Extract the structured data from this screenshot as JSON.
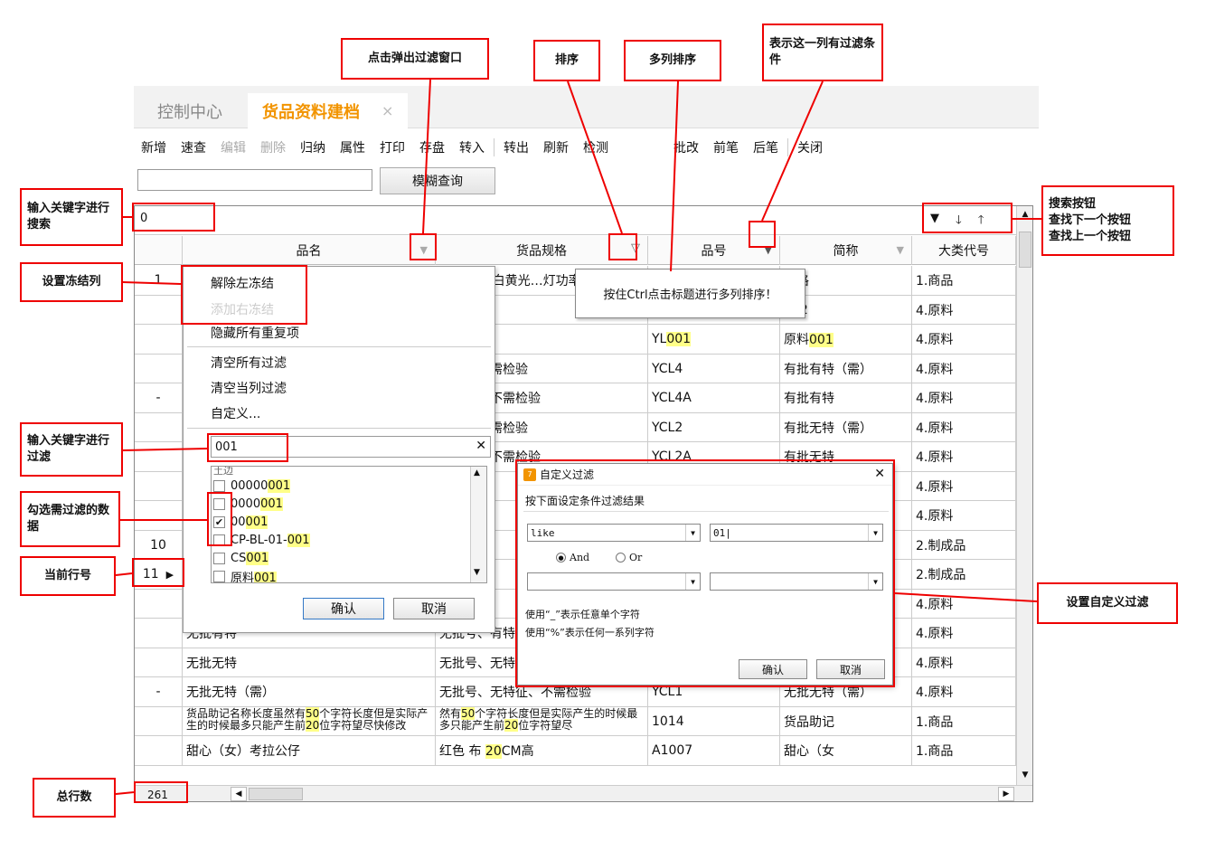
{
  "tabs": [
    {
      "label": "控制中心"
    },
    {
      "label": "货品资料建档",
      "close": "×"
    }
  ],
  "toolbar": [
    "新增",
    "速查",
    "编辑",
    "删除",
    "归纳",
    "属性",
    "打印",
    "存盘",
    "转入",
    "转出",
    "刷新",
    "检测",
    "批改",
    "前笔",
    "后笔",
    "关闭"
  ],
  "toolbar_disabled": [
    "编辑",
    "删除"
  ],
  "search": {
    "button": "模糊查询"
  },
  "filter_bar": {
    "value": "0"
  },
  "columns": [
    "品名",
    "货品规格",
    "品号",
    "简称",
    "大类代号"
  ],
  "rows": [
    {
      "num": "1",
      "spec": "0V 8655白黄光…灯功率28W",
      "code": "",
      "short": "规格",
      "cat": "1.商品"
    },
    {
      "num": "",
      "spec": "易碎",
      "code": "",
      "short": "002",
      "cat": "4.原料"
    },
    {
      "num": "",
      "spec": "12个一盒",
      "code": "YL001",
      "short": "原料001",
      "cat": "4.原料"
    },
    {
      "num": "",
      "spec": "有特征、需检验",
      "code": "YCL4",
      "short": "有批有特（需）",
      "cat": "4.原料"
    },
    {
      "num": "-",
      "spec": "有特征、不需检验",
      "code": "YCL4A",
      "short": "有批有特",
      "cat": "4.原料"
    },
    {
      "num": "",
      "spec": "无特征、需检验",
      "code": "YCL2",
      "short": "有批无特（需）",
      "cat": "4.原料"
    },
    {
      "num": "",
      "spec": "无特征、不需检验",
      "code": "YCL2A",
      "short": "有批无特",
      "cat": "4.原料"
    },
    {
      "num": "",
      "spec": "",
      "code": "",
      "short": "",
      "cat": "4.原料"
    },
    {
      "num": "",
      "spec": "",
      "code": "",
      "short": "",
      "cat": "4.原料"
    },
    {
      "num": "10",
      "spec": "",
      "code": "",
      "short": "",
      "cat": "2.制成品"
    },
    {
      "num": "11",
      "spec": "",
      "code": "",
      "short": "",
      "cat": "2.制成品"
    },
    {
      "num": "",
      "name": "",
      "spec": "有特",
      "code": "",
      "short": "",
      "cat": "4.原料"
    },
    {
      "num": "",
      "name": "无批有特",
      "spec": "无批号、有特",
      "code": "",
      "short": "",
      "cat": "4.原料"
    },
    {
      "num": "",
      "name": "无批无特",
      "spec": "无批号、无特",
      "code": "",
      "short": "",
      "cat": "4.原料"
    },
    {
      "num": "-",
      "name": "无批无特（需）",
      "spec": "无批号、无特征、不需检验",
      "code": "YCL1",
      "short": "无批无特（需）",
      "cat": "4.原料"
    },
    {
      "num": "",
      "name": "货品助记名称长度虽然有50个字符长度但是实际产生的时候最多只能产生前20位字符望尽快修改",
      "spec": "然有50个字符长度但是实际产生的时候最多只能产生前20位字符望尽",
      "code": "1014",
      "short": "货品助记",
      "cat": "1.商品"
    },
    {
      "num": "",
      "name": "甜心（女）考拉公仔",
      "spec": "红色 布 20CM高",
      "code": "A1007",
      "short": "甜心（女",
      "cat": "1.商品"
    }
  ],
  "total_rows": "261",
  "context_menu": {
    "items": [
      "解除左冻结",
      "添加右冻结",
      "隐藏所有重复项",
      "清空所有过滤",
      "清空当列过滤",
      "自定义..."
    ],
    "filter_value": "001",
    "clear": "✕",
    "list_top": "土边",
    "checklist": [
      {
        "label": "00000001",
        "checked": false
      },
      {
        "label": "0000001",
        "checked": false
      },
      {
        "label": "00001",
        "checked": true
      },
      {
        "label": "CP-BL-01-001",
        "checked": false
      },
      {
        "label": "CS001",
        "checked": false
      },
      {
        "label": "原料001",
        "checked": false
      }
    ],
    "ok": "确认",
    "cancel": "取消"
  },
  "tooltip": "按住Ctrl点击标题进行多列排序！",
  "dialog": {
    "title": "自定义过滤",
    "logo": "7",
    "close": "✕",
    "instruction": "按下面设定条件过滤结果",
    "op1": "like",
    "val1": "01|",
    "and": "And",
    "or": "Or",
    "hint1": "使用“_”表示任意单个字符",
    "hint2": "使用“%”表示任何一系列字符",
    "ok": "确认",
    "cancel": "取消"
  },
  "callouts": {
    "filter_popup": "点击弹出过滤窗口",
    "sort": "排序",
    "multi_sort": "多列排序",
    "has_filter": "表示这一列有过滤条件",
    "search_keyword": "输入关键字进行搜索",
    "search_buttons": "搜索按钮\n查找下一个按钮\n查找上一个按钮",
    "freeze": "设置冻结列",
    "filter_keyword": "输入关键字进行过滤",
    "check_filter": "勾选需过滤的数据",
    "current_row": "当前行号",
    "total": "总行数",
    "custom_filter": "设置自定义过滤"
  },
  "colors": {
    "accent": "#f29400",
    "annotation": "#ee0000",
    "highlight": "#ffff88"
  }
}
